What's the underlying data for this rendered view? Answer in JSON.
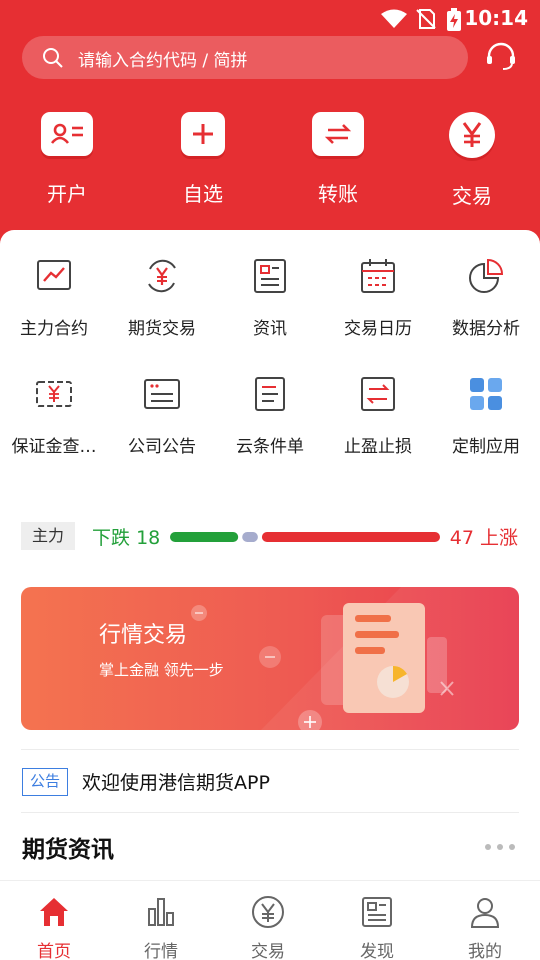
{
  "status_bar": {
    "time": "10:14"
  },
  "search": {
    "placeholder": "请输入合约代码 / 简拼"
  },
  "quick_actions": [
    {
      "label": "开户",
      "icon": "id-card-icon"
    },
    {
      "label": "自选",
      "icon": "plus-icon"
    },
    {
      "label": "转账",
      "icon": "transfer-icon"
    },
    {
      "label": "交易",
      "icon": "yen-icon"
    }
  ],
  "grid": [
    {
      "label": "主力合约",
      "icon": "trend-chart-icon"
    },
    {
      "label": "期货交易",
      "icon": "yen-cycle-icon"
    },
    {
      "label": "资讯",
      "icon": "news-icon"
    },
    {
      "label": "交易日历",
      "icon": "calendar-icon"
    },
    {
      "label": "数据分析",
      "icon": "pie-chart-icon"
    },
    {
      "label": "保证金查…",
      "icon": "margin-bill-icon"
    },
    {
      "label": "公司公告",
      "icon": "announcement-icon"
    },
    {
      "label": "云条件单",
      "icon": "document-icon"
    },
    {
      "label": "止盈止损",
      "icon": "swap-icon"
    },
    {
      "label": "定制应用",
      "icon": "apps-grid-icon"
    }
  ],
  "market": {
    "tag": "主力",
    "down_label": "下跌",
    "down_count": "18",
    "up_label": "上涨",
    "up_count": "47",
    "flat_count": 0.06,
    "colors": {
      "down": "#23a03a",
      "up": "#e62f33",
      "flat": "#a6accd"
    }
  },
  "banner": {
    "title": "行情交易",
    "subtitle": "掌上金融  领先一步"
  },
  "notice": {
    "tag": "公告",
    "text": "欢迎使用港信期货APP"
  },
  "section": {
    "title": "期货资讯"
  },
  "tabbar": [
    {
      "label": "首页",
      "icon": "home-icon",
      "active": true
    },
    {
      "label": "行情",
      "icon": "bar-chart-icon",
      "active": false
    },
    {
      "label": "交易",
      "icon": "yen-circle-icon",
      "active": false
    },
    {
      "label": "发现",
      "icon": "newspaper-icon",
      "active": false
    },
    {
      "label": "我的",
      "icon": "user-icon",
      "active": false
    }
  ],
  "colors": {
    "brand": "#e62f33",
    "accent_blue": "#3d7ee0"
  }
}
